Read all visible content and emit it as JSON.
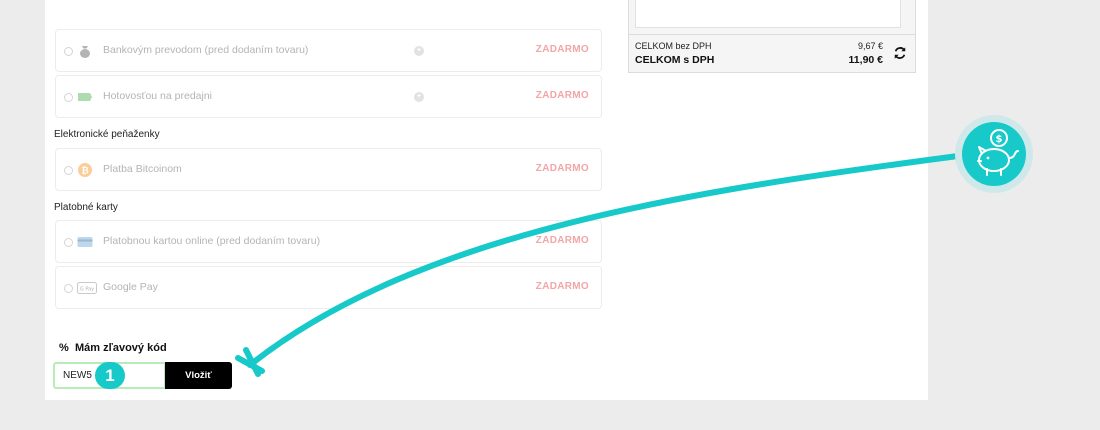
{
  "payment_methods": [
    {
      "label": "Bankovým prevodom (pred dodaním tovaru)",
      "price": "ZADARMO",
      "icon": "money-bag-icon",
      "info": true
    },
    {
      "label": "Hotovosťou na predajni",
      "price": "ZADARMO",
      "icon": "banknote-icon",
      "info": true
    },
    {
      "label": "Platba Bitcoinom",
      "price": "ZADARMO",
      "icon": "bitcoin-icon",
      "info": false
    },
    {
      "label": "Platobnou kartou online (pred dodaním tovaru)",
      "price": "ZADARMO",
      "icon": "credit-card-icon",
      "info": false
    },
    {
      "label": "Google Pay",
      "price": "ZADARMO",
      "icon": "google-pay-icon",
      "info": false
    }
  ],
  "info_glyph": "+",
  "google_pay_mark": "G Pay",
  "sections": {
    "wallets": "Elektronické peňaženky",
    "cards": "Platobné karty"
  },
  "summary": {
    "without_vat_label": "CELKOM bez DPH",
    "without_vat_value": "9,67 €",
    "with_vat_label": "CELKOM s DPH",
    "with_vat_value": "11,90 €"
  },
  "discount": {
    "symbol": "%",
    "title": "Mám zľavový kód",
    "code_value": "NEW5",
    "submit_label": "Vložiť"
  },
  "annotation": {
    "step_number": "1",
    "accent_color": "#18c9c9"
  },
  "colors": {
    "price_free": "#f2a6a6",
    "page_background": "#ececec",
    "button": "#000000"
  }
}
